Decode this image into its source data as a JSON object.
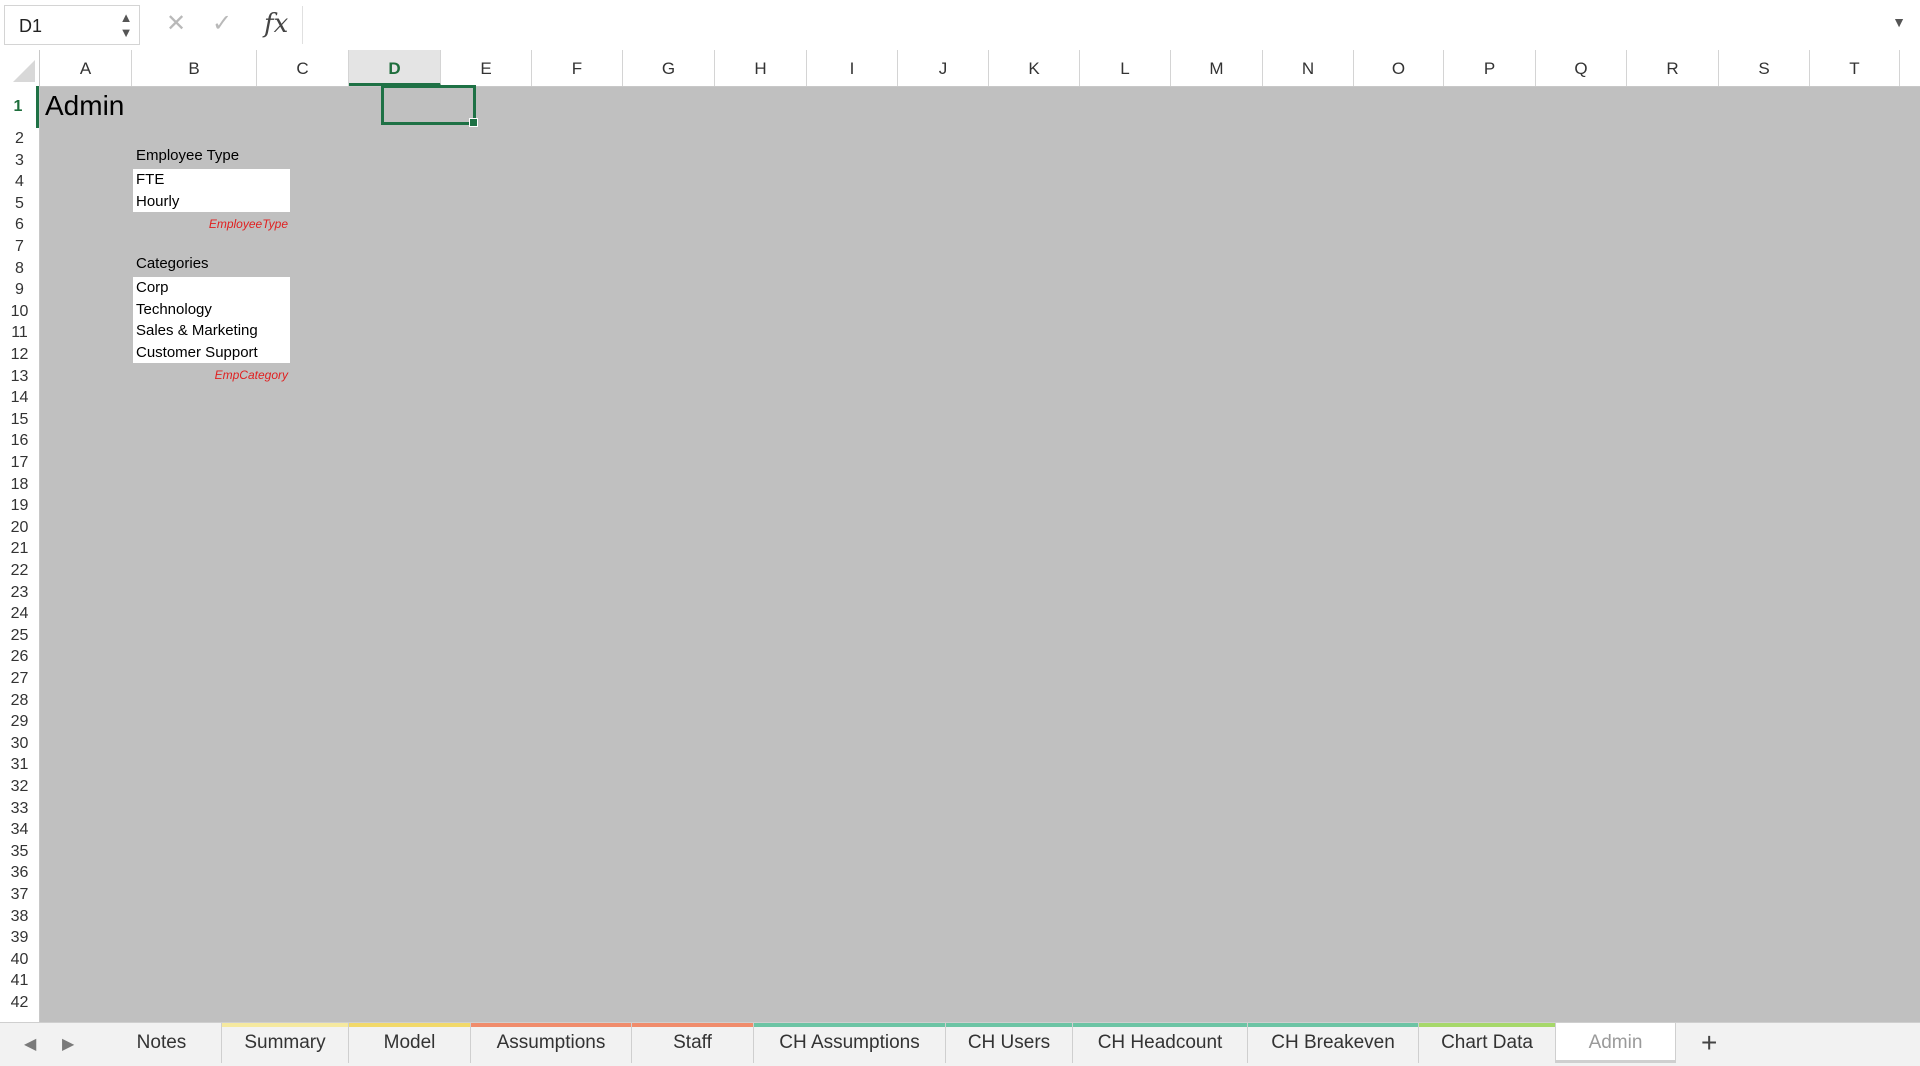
{
  "formula_bar": {
    "name_box": "D1",
    "cancel_icon": "x-icon",
    "enter_icon": "check-icon",
    "fx_label": "fx",
    "formula": ""
  },
  "columns": [
    "A",
    "B",
    "C",
    "D",
    "E",
    "F",
    "G",
    "H",
    "I",
    "J",
    "K",
    "L",
    "M",
    "N",
    "O",
    "P",
    "Q",
    "R",
    "S",
    "T"
  ],
  "active_column": "D",
  "rows": [
    "1",
    "2",
    "3",
    "4",
    "5",
    "6",
    "7",
    "8",
    "9",
    "10",
    "11",
    "12",
    "13",
    "14",
    "15",
    "16",
    "17",
    "18",
    "19",
    "20",
    "21",
    "22",
    "23",
    "24",
    "25",
    "26",
    "27",
    "28",
    "29",
    "30",
    "31",
    "32",
    "33",
    "34",
    "35",
    "36",
    "37",
    "38",
    "39",
    "40",
    "41",
    "42"
  ],
  "active_row": "1",
  "sheet": {
    "title": "Admin",
    "employee_type": {
      "header": "Employee Type",
      "items": [
        "FTE",
        "Hourly"
      ],
      "range_name": "EmployeeType"
    },
    "categories": {
      "header": "Categories",
      "items": [
        "Corp",
        "Technology",
        "Sales & Marketing",
        "Customer Support"
      ],
      "range_name": "EmpCategory"
    }
  },
  "tabs": [
    {
      "label": "Notes",
      "color": ""
    },
    {
      "label": "Summary",
      "color": "#f5e9a0"
    },
    {
      "label": "Model",
      "color": "#f2d96a"
    },
    {
      "label": "Assumptions",
      "color": "#f08c6c"
    },
    {
      "label": "Staff",
      "color": "#f08c6c"
    },
    {
      "label": "CH Assumptions",
      "color": "#6cc4a4"
    },
    {
      "label": "CH Users",
      "color": "#6cc4a4"
    },
    {
      "label": "CH Headcount",
      "color": "#6cc4a4"
    },
    {
      "label": "CH Breakeven",
      "color": "#6cc4a4"
    },
    {
      "label": "Chart Data",
      "color": "#a6d86a"
    },
    {
      "label": "Admin",
      "color": ""
    }
  ],
  "active_tab": "Admin",
  "add_tab_label": "+"
}
